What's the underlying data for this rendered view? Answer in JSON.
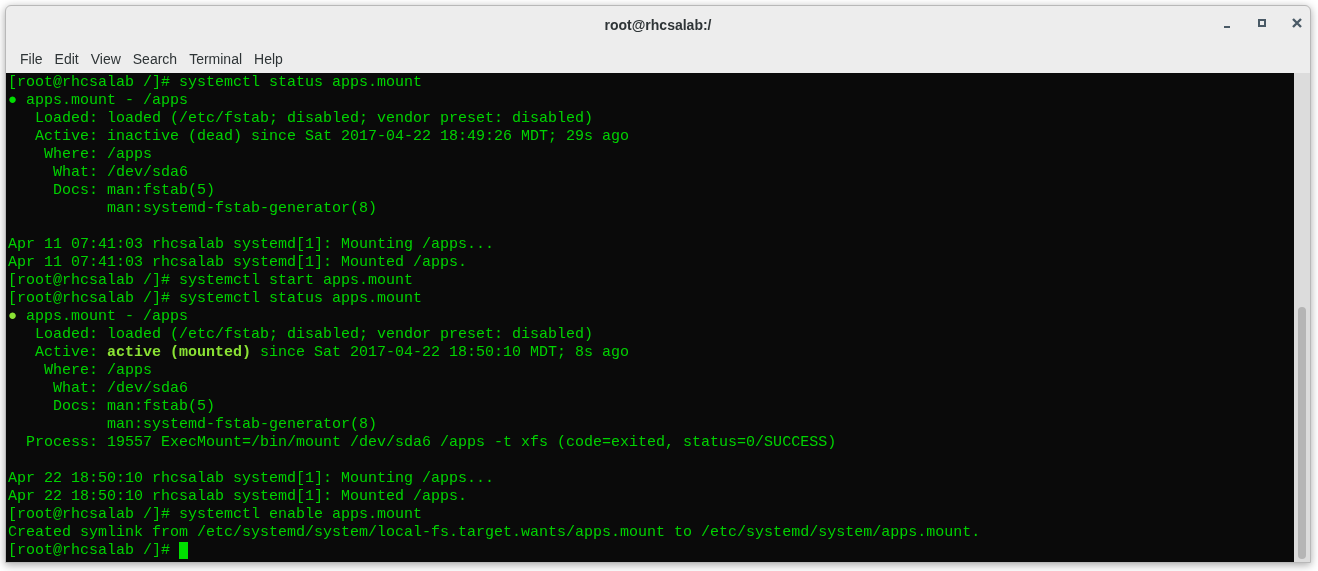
{
  "window": {
    "title": "root@rhcsalab:/"
  },
  "menu": [
    "File",
    "Edit",
    "View",
    "Search",
    "Terminal",
    "Help"
  ],
  "terminal": {
    "lines": [
      {
        "kind": "text",
        "segments": [
          {
            "kind": "text",
            "text": "[root@rhcsalab /]# systemctl status apps.mount"
          }
        ]
      },
      {
        "kind": "text",
        "segments": [
          {
            "kind": "dot",
            "text": "●",
            "color": "#00dd00"
          },
          {
            "kind": "text",
            "text": " apps.mount - /apps"
          }
        ]
      },
      {
        "kind": "text",
        "segments": [
          {
            "kind": "text",
            "text": "   Loaded: loaded (/etc/fstab; disabled; vendor preset: disabled)"
          }
        ]
      },
      {
        "kind": "text",
        "segments": [
          {
            "kind": "text",
            "text": "   Active: inactive (dead) since Sat 2017-04-22 18:49:26 MDT; 29s ago"
          }
        ]
      },
      {
        "kind": "text",
        "segments": [
          {
            "kind": "text",
            "text": "    Where: /apps"
          }
        ]
      },
      {
        "kind": "text",
        "segments": [
          {
            "kind": "text",
            "text": "     What: /dev/sda6"
          }
        ]
      },
      {
        "kind": "text",
        "segments": [
          {
            "kind": "text",
            "text": "     Docs: man:fstab(5)"
          }
        ]
      },
      {
        "kind": "text",
        "segments": [
          {
            "kind": "text",
            "text": "           man:systemd-fstab-generator(8)"
          }
        ]
      },
      {
        "kind": "blank"
      },
      {
        "kind": "text",
        "segments": [
          {
            "kind": "text",
            "text": "Apr 11 07:41:03 rhcsalab systemd[1]: Mounting /apps..."
          }
        ]
      },
      {
        "kind": "text",
        "segments": [
          {
            "kind": "text",
            "text": "Apr 11 07:41:03 rhcsalab systemd[1]: Mounted /apps."
          }
        ]
      },
      {
        "kind": "text",
        "segments": [
          {
            "kind": "text",
            "text": "[root@rhcsalab /]# systemctl start apps.mount"
          }
        ]
      },
      {
        "kind": "text",
        "segments": [
          {
            "kind": "text",
            "text": "[root@rhcsalab /]# systemctl status apps.mount"
          }
        ]
      },
      {
        "kind": "text",
        "segments": [
          {
            "kind": "dot",
            "text": "●",
            "color": "#8ae234"
          },
          {
            "kind": "text",
            "text": " apps.mount - /apps"
          }
        ]
      },
      {
        "kind": "text",
        "segments": [
          {
            "kind": "text",
            "text": "   Loaded: loaded (/etc/fstab; disabled; vendor preset: disabled)"
          }
        ]
      },
      {
        "kind": "text",
        "segments": [
          {
            "kind": "text",
            "text": "   Active: "
          },
          {
            "kind": "bold",
            "text": "active (mounted)"
          },
          {
            "kind": "text",
            "text": " since Sat 2017-04-22 18:50:10 MDT; 8s ago"
          }
        ]
      },
      {
        "kind": "text",
        "segments": [
          {
            "kind": "text",
            "text": "    Where: /apps"
          }
        ]
      },
      {
        "kind": "text",
        "segments": [
          {
            "kind": "text",
            "text": "     What: /dev/sda6"
          }
        ]
      },
      {
        "kind": "text",
        "segments": [
          {
            "kind": "text",
            "text": "     Docs: man:fstab(5)"
          }
        ]
      },
      {
        "kind": "text",
        "segments": [
          {
            "kind": "text",
            "text": "           man:systemd-fstab-generator(8)"
          }
        ]
      },
      {
        "kind": "text",
        "segments": [
          {
            "kind": "text",
            "text": "  Process: 19557 ExecMount=/bin/mount /dev/sda6 /apps -t xfs (code=exited, status=0/SUCCESS)"
          }
        ]
      },
      {
        "kind": "blank"
      },
      {
        "kind": "text",
        "segments": [
          {
            "kind": "text",
            "text": "Apr 22 18:50:10 rhcsalab systemd[1]: Mounting /apps..."
          }
        ]
      },
      {
        "kind": "text",
        "segments": [
          {
            "kind": "text",
            "text": "Apr 22 18:50:10 rhcsalab systemd[1]: Mounted /apps."
          }
        ]
      },
      {
        "kind": "text",
        "segments": [
          {
            "kind": "text",
            "text": "[root@rhcsalab /]# systemctl enable apps.mount"
          }
        ]
      },
      {
        "kind": "text",
        "segments": [
          {
            "kind": "text",
            "text": "Created symlink from /etc/systemd/system/local-fs.target.wants/apps.mount to /etc/systemd/system/apps.mount."
          }
        ]
      },
      {
        "kind": "text",
        "cursor": true,
        "segments": [
          {
            "kind": "text",
            "text": "[root@rhcsalab /]# "
          }
        ]
      }
    ]
  }
}
